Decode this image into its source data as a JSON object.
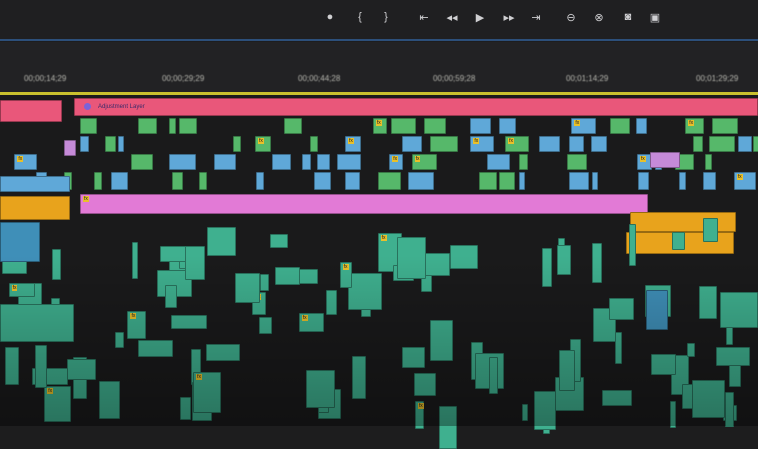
{
  "toolbar": {
    "icons": [
      "marker-icon",
      "in-point-icon",
      "out-point-icon",
      "go-to-in-icon",
      "step-back-icon",
      "play-icon",
      "step-forward-icon",
      "go-to-out-icon",
      "lift-icon",
      "extract-icon",
      "export-frame-icon",
      "comparison-icon"
    ]
  },
  "ruler": {
    "timecodes": [
      "00;00;14;29",
      "00;00;29;29",
      "00;00;44;28",
      "00;00;59;28",
      "00;01;14;29",
      "00;01;29;29"
    ]
  },
  "timeline": {
    "adjustment_layer_label": "Adjustment Layer",
    "fx_label": "fx"
  },
  "colors": {
    "adjustment": "#e9577a",
    "video_blue": "#5fa8d8",
    "video_green": "#56b86a",
    "audio_pink": "#e27ad6",
    "audio_orange": "#e8a31c",
    "audio_teal": "#3fb08f",
    "playhead_line": "#c9c12e"
  }
}
